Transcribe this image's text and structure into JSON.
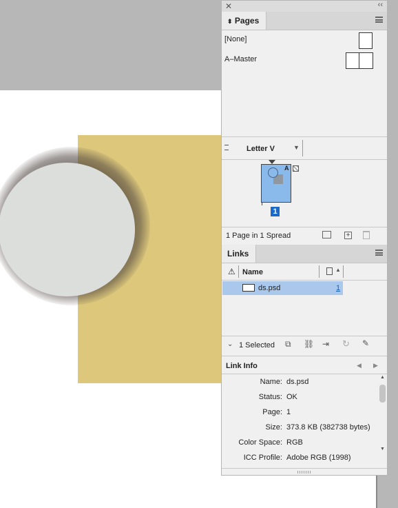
{
  "pages_panel": {
    "tab_label": "Pages",
    "masters": [
      {
        "label": "[None]"
      },
      {
        "label": "A–Master"
      }
    ],
    "size_label": "Letter V",
    "page_number": "1",
    "master_prefix": "A",
    "status": "1 Page in 1 Spread"
  },
  "links_panel": {
    "tab_label": "Links",
    "column_name": "Name",
    "file_name": "ds.psd",
    "file_page": "1",
    "selected_label": "1 Selected",
    "info_label": "Link Info",
    "info": [
      {
        "key": "Name:",
        "value": "ds.psd"
      },
      {
        "key": "Status:",
        "value": "OK"
      },
      {
        "key": "Page:",
        "value": "1"
      },
      {
        "key": "Size:",
        "value": "373.8 KB (382738 bytes)"
      },
      {
        "key": "Color Space:",
        "value": "RGB"
      },
      {
        "key": "ICC Profile:",
        "value": "Adobe RGB (1998)"
      }
    ]
  },
  "colors": {
    "accent": "#1b6ac9",
    "selection": "#a9c8ec",
    "document_rect": "#dcc77b",
    "circle": "#dcdedb"
  }
}
